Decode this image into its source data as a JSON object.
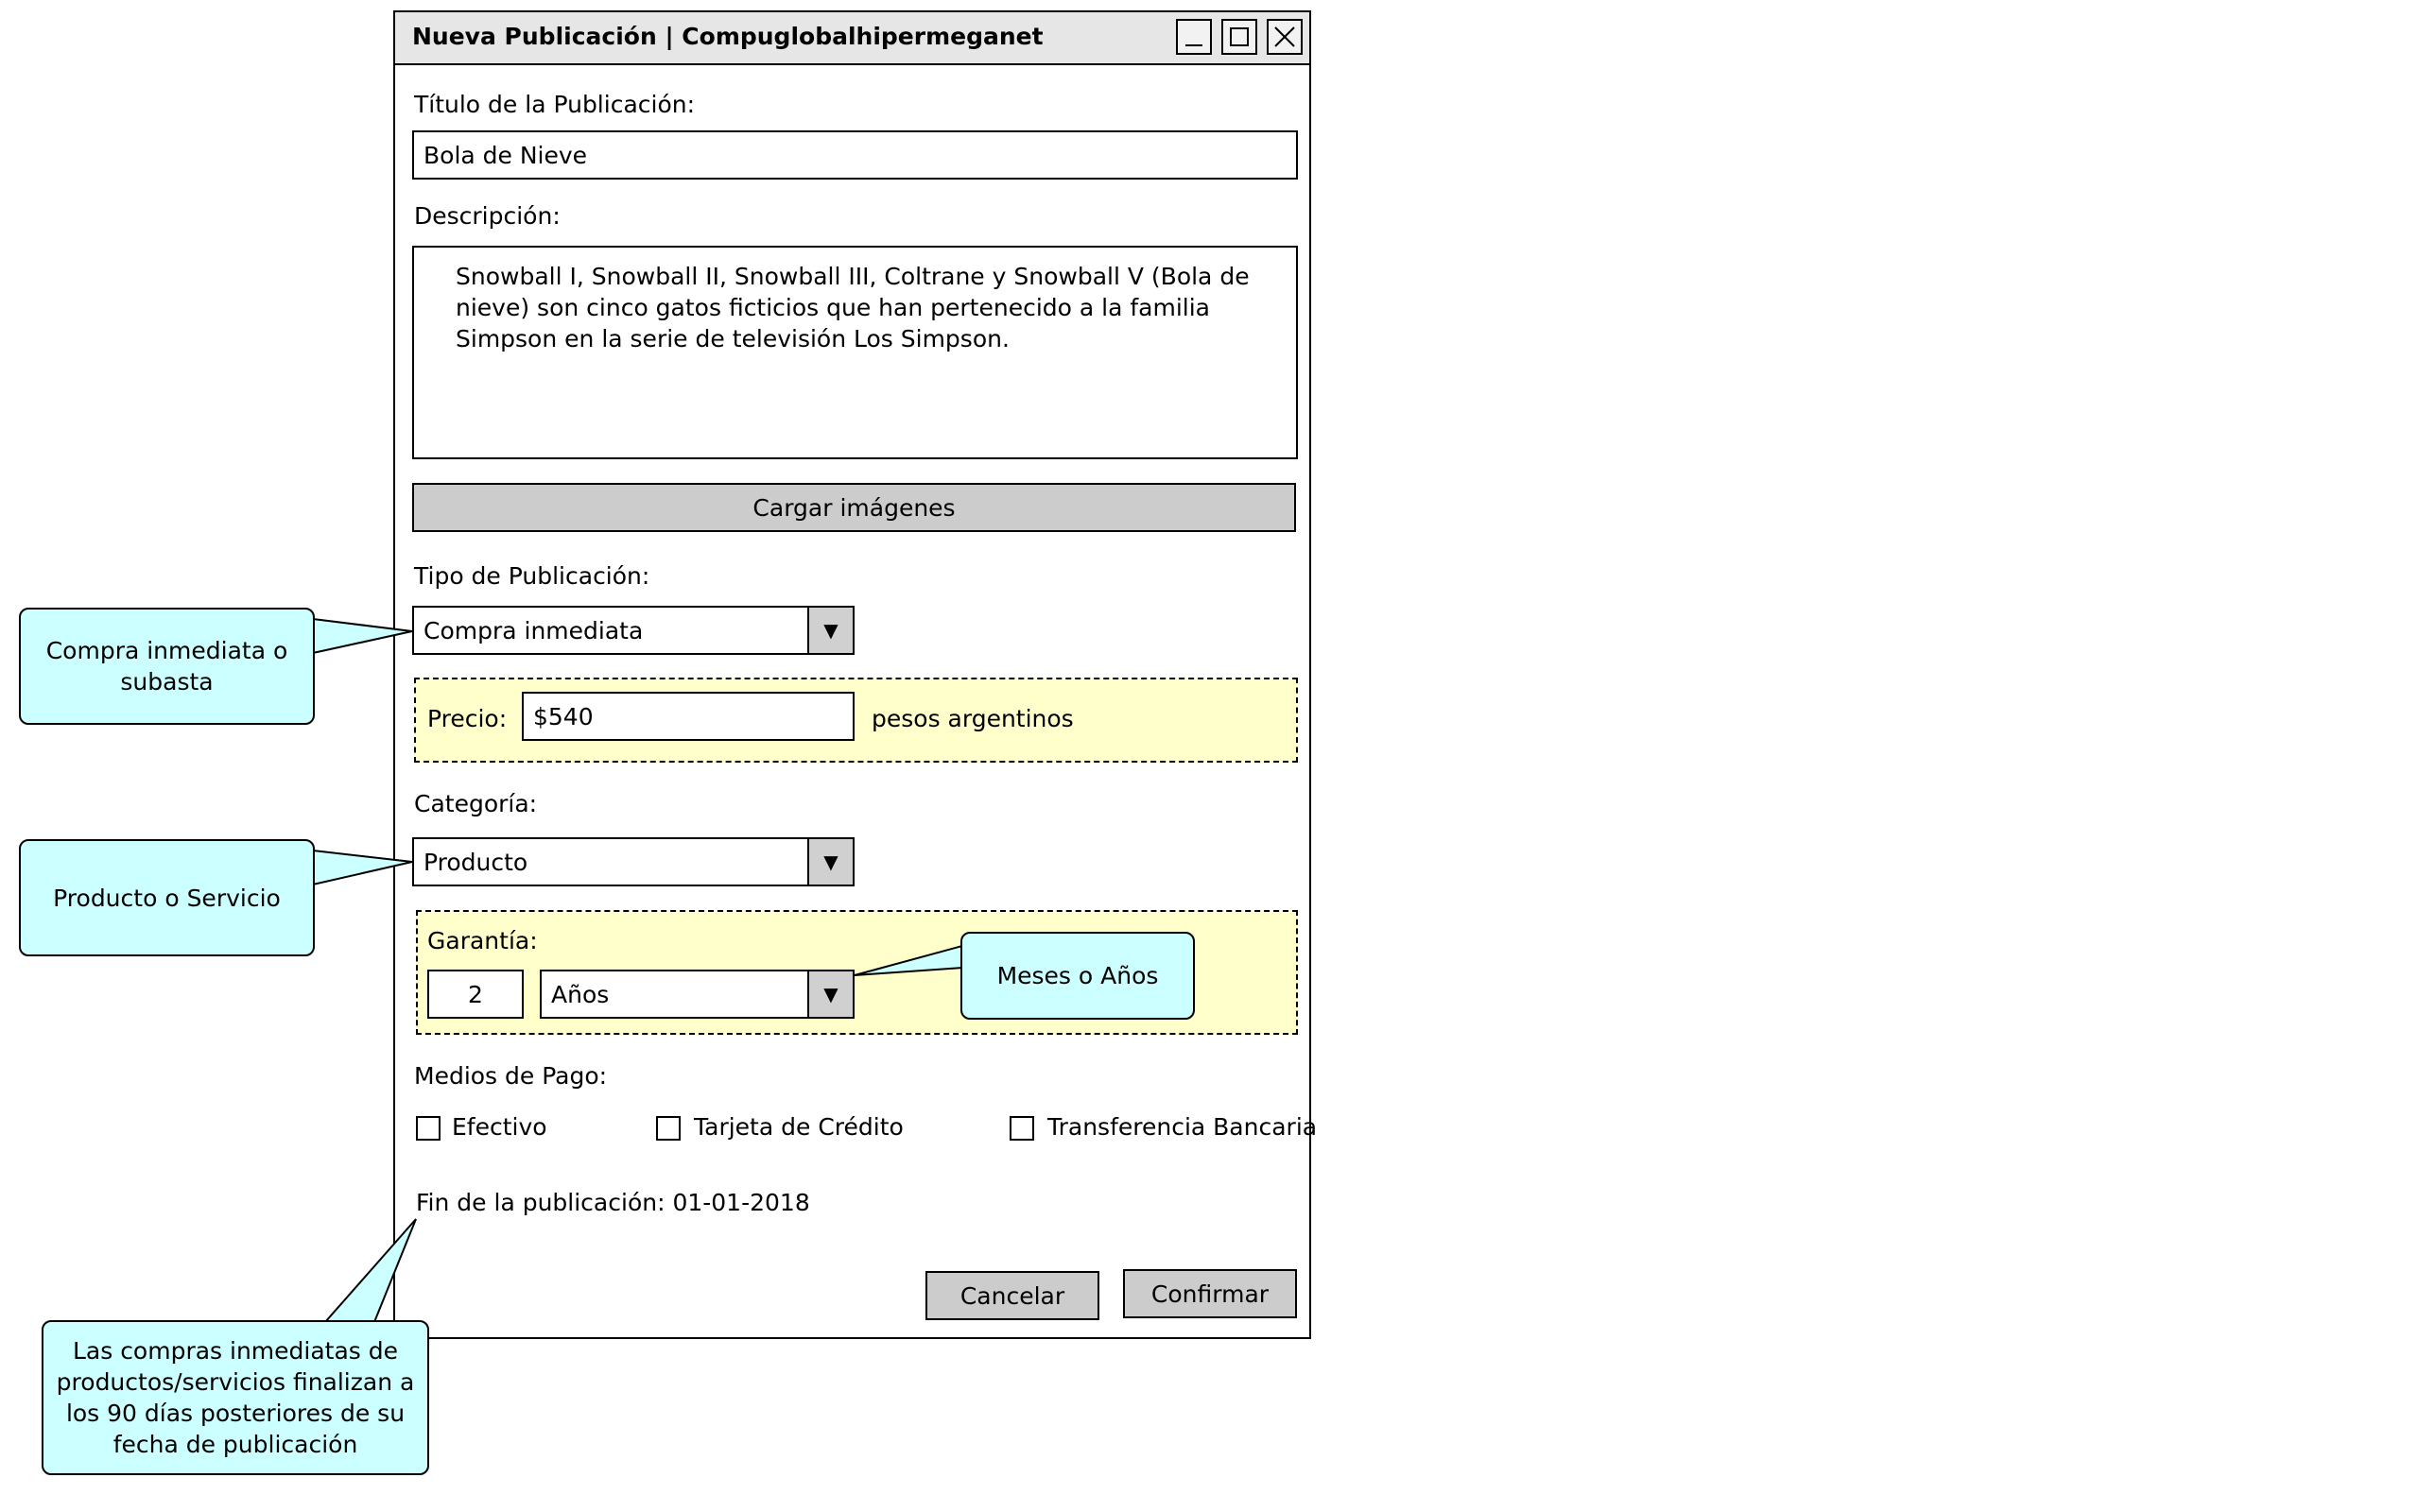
{
  "window": {
    "title": "Nueva Publicación | Compuglobalhipermeganet",
    "minimize_label": "_"
  },
  "form": {
    "title_label": "Título de la Publicación:",
    "title_value": "Bola de Nieve",
    "description_label": "Descripción:",
    "description_value": "Snowball I, Snowball II, Snowball III, Coltrane y Snowball V (Bola de nieve) son cinco gatos ficticios que han pertenecido a la familia Simpson en la serie de televisión Los Simpson.",
    "upload_button": "Cargar imágenes",
    "type_label": "Tipo de Publicación:",
    "type_value": "Compra inmediata",
    "price_label": "Precio:",
    "price_value": "$540",
    "price_unit": "pesos argentinos",
    "category_label": "Categoría:",
    "category_value": "Producto",
    "warranty_label": "Garantía:",
    "warranty_amount": "2",
    "warranty_unit": "Años",
    "payment_label": "Medios de Pago:",
    "payment_options": [
      "Efectivo",
      "Tarjeta de Crédito",
      "Transferencia Bancaria"
    ],
    "end_date_text": "Fin de la publicación: 01-01-2018",
    "cancel_button": "Cancelar",
    "confirm_button": "Confirmar",
    "dropdown_arrow": "▼"
  },
  "callouts": {
    "type_note": "Compra inmediata o subasta",
    "category_note": "Producto o Servicio",
    "warranty_note": "Meses o Años",
    "end_note": "Las compras inmediatas de productos/servicios finalizan a los 90 días posteriores de su fecha de publicación"
  },
  "colors": {
    "callout_fill": "#ccffff",
    "group_fill": "#ffffcc",
    "titlebar": "#e6e6e6",
    "button": "#cccccc"
  }
}
